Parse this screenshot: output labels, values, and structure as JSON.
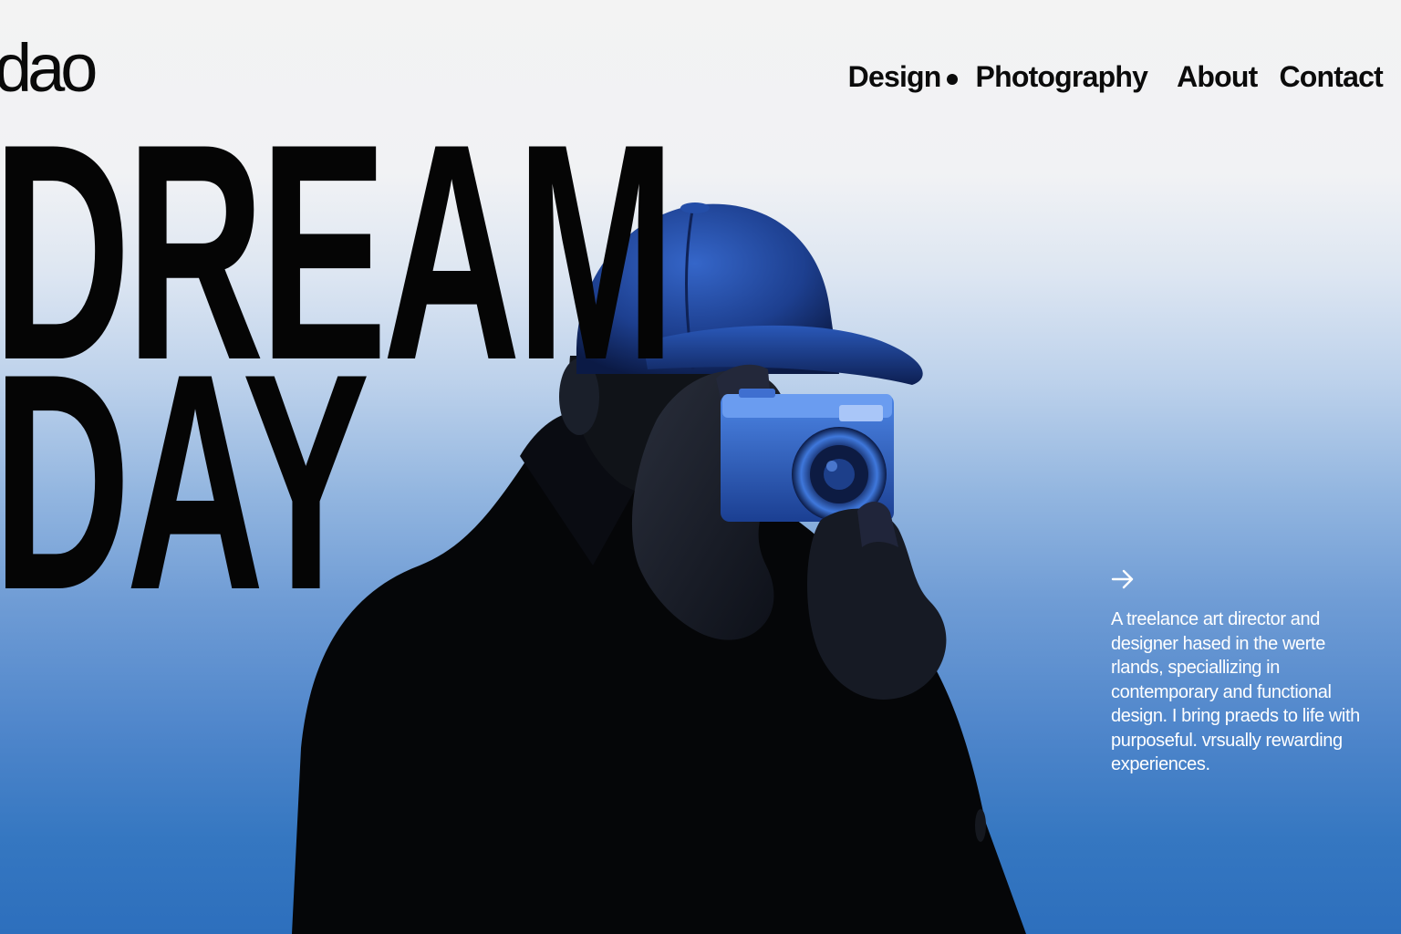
{
  "brand": {
    "logo_text": "dao"
  },
  "nav": {
    "items": [
      {
        "label": "Design"
      },
      {
        "label": "Photography"
      },
      {
        "label": "About"
      },
      {
        "label": "Contact"
      }
    ]
  },
  "hero": {
    "headline_line1": "DREAM",
    "headline_line2": "DAY",
    "arrow_icon": "arrow-right-icon",
    "bio": "A treelance art director and designer hased in the werte rlands, speciallizing in contemporary and functional design. I bring praeds to life with purposeful. vrsually rewarding experiences."
  },
  "colors": {
    "background_top": "#f3f3f3",
    "background_bottom": "#2d6fbd",
    "text_dark": "#0b0b0b",
    "text_light": "#ffffff",
    "accent_blue": "#2f6fd0"
  }
}
